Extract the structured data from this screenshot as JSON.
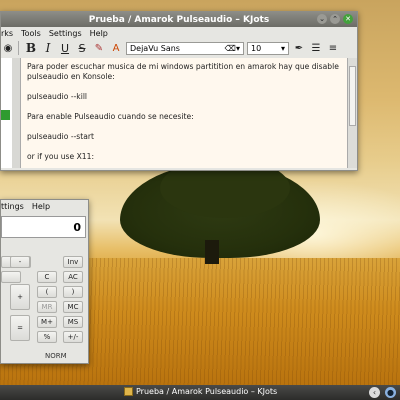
{
  "kjots": {
    "title": "Prueba / Amarok Pulseaudio – KJots",
    "menu": [
      "rks",
      "Tools",
      "Settings",
      "Help"
    ],
    "font": "DejaVu Sans",
    "size": "10",
    "lines": [
      "Para poder escuchar musica de mi windows partitition en amarok hay que disable pulseaudio en Konsole:",
      "pulseaudio --kill",
      "Para enable Pulseaudio cuando se necesite:",
      "pulseaudio --start",
      "or if you use X11:"
    ]
  },
  "calc": {
    "menu": [
      "ttings",
      "Help"
    ],
    "display": "0",
    "buttons": {
      "inv": "Inv",
      "c": "C",
      "ac": "AC",
      "lparen": "(",
      "rparen": ")",
      "mr": "MR",
      "mc": "MC",
      "mplus": "M+",
      "ms": "MS",
      "percent": "%",
      "plusminus": "+/-",
      "plus": "+",
      "equals": "=",
      "minus": "-"
    },
    "mode": "NORM"
  },
  "taskbar": {
    "task": "Prueba / Amarok Pulseaudio – KJots"
  }
}
